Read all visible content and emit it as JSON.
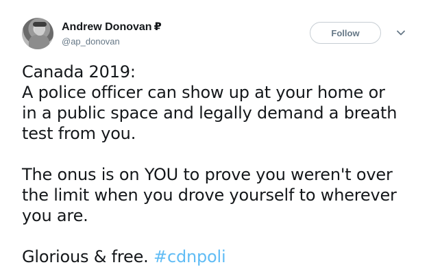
{
  "author": {
    "display_name": "Andrew Donovan",
    "badge": "₽",
    "handle": "@ap_donovan"
  },
  "actions": {
    "follow_label": "Follow",
    "menu_icon": "chevron-down-icon"
  },
  "tweet": {
    "lines": [
      "Canada 2019:",
      "A police officer can show up at your home or",
      "in a public space and legally demand a breath",
      "test from you.",
      "The onus is on YOU to prove you weren't over",
      "the limit when you drove yourself to wherever",
      "you are.",
      "Glorious & free."
    ],
    "hashtag": "#cdnpoli"
  },
  "colors": {
    "text": "#14171a",
    "muted": "#657786",
    "hashtag": "#1da1f2",
    "border": "#c6cdd3"
  }
}
